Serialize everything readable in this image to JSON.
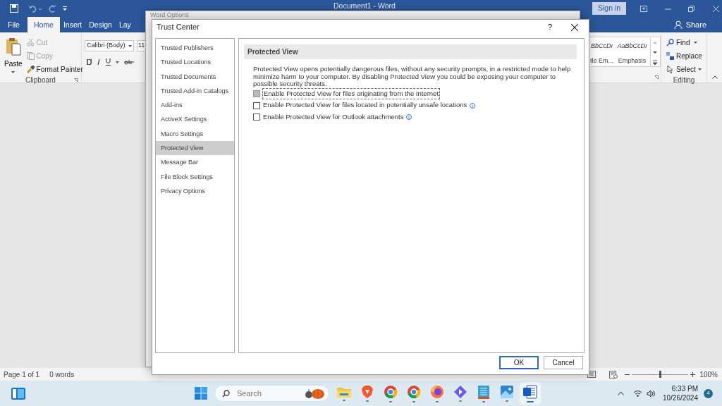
{
  "word_window": {
    "title": "Document1 - Word",
    "sign_in": "Sign in",
    "tabs": [
      {
        "label": "File",
        "selected": false
      },
      {
        "label": "Home",
        "selected": true
      },
      {
        "label": "Insert",
        "selected": false
      },
      {
        "label": "Design",
        "selected": false
      },
      {
        "label": "Lay",
        "selected": false
      }
    ],
    "share": "Share",
    "clipboard": {
      "paste": "Paste",
      "cut": {
        "label": "Cut",
        "disabled": true
      },
      "copy": {
        "label": "Copy",
        "disabled": true
      },
      "format_painter": "Format Painter",
      "label": "Clipboard"
    },
    "font": {
      "name": "Calibri (Body)",
      "size": "11"
    },
    "styles": [
      {
        "sample": "BbCcDı",
        "name": "tle Em..."
      },
      {
        "sample": "AaBbCcDı",
        "name": "Emphasis"
      }
    ],
    "editing": {
      "find": "Find",
      "replace": "Replace",
      "select": "Select",
      "label": "Editing"
    },
    "status_bar": {
      "page": "Page 1 of 1",
      "words": "0 words",
      "zoom": {
        "level": 0.5
      },
      "zoom_reading": "100%"
    }
  },
  "word_options": {
    "title": "Word Options"
  },
  "trust_center": {
    "title": "Trust Center",
    "help": "?",
    "nav": [
      {
        "label": "Trusted Publishers",
        "selected": false
      },
      {
        "label": "Trusted Locations",
        "selected": false
      },
      {
        "label": "Trusted Documents",
        "selected": false
      },
      {
        "label": "Trusted Add-in Catalogs",
        "selected": false
      },
      {
        "label": "Add-ins",
        "selected": false
      },
      {
        "label": "ActiveX Settings",
        "selected": false
      },
      {
        "label": "Macro Settings",
        "selected": false
      },
      {
        "label": "Protected View",
        "selected": true
      },
      {
        "label": "Message Bar",
        "selected": false
      },
      {
        "label": "File Block Settings",
        "selected": false
      },
      {
        "label": "Privacy Options",
        "selected": false
      }
    ],
    "section_title": "Protected View",
    "description": "Protected View opens potentially dangerous files, without any security prompts, in a restricted mode to help minimize harm to your computer. By disabling Protected View you could be exposing your computer to possible security threats.",
    "options": [
      {
        "label": "Enable Protected View for files originating from the Internet",
        "checked": false,
        "pressed": true,
        "info": false
      },
      {
        "label": "Enable Protected View for files located in potentially unsafe locations",
        "checked": false,
        "pressed": false,
        "info": true
      },
      {
        "label": "Enable Protected View for Outlook attachments",
        "checked": false,
        "pressed": false,
        "info": true
      }
    ],
    "buttons": [
      {
        "label": "OK",
        "default": true
      },
      {
        "label": "Cancel",
        "default": false
      }
    ]
  },
  "taskbar": {
    "search": {
      "placeholder": "Search"
    },
    "apps": [
      {
        "kind": "folder",
        "selected": false
      },
      {
        "kind": "shield",
        "selected": false
      },
      {
        "kind": "ring",
        "selected": false
      },
      {
        "kind": "ring",
        "selected": false
      },
      {
        "kind": "fox",
        "selected": false
      },
      {
        "kind": "diamond",
        "selected": false
      },
      {
        "kind": "notepad",
        "selected": false
      },
      {
        "kind": "photo",
        "selected": false
      },
      {
        "kind": "document",
        "selected": true
      }
    ],
    "time": "6:33 PM",
    "date": "10/26/2024",
    "notification_count": "4"
  }
}
